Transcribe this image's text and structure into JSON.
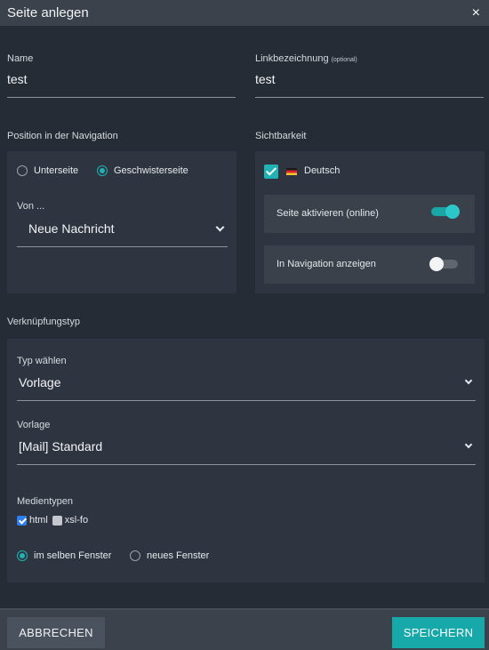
{
  "dialog": {
    "title": "Seite anlegen",
    "close_symbol": "×"
  },
  "name_field": {
    "label": "Name",
    "value": "test"
  },
  "link_field": {
    "label": "Linkbezeichnung",
    "optional_note": "(optional)",
    "value": "test"
  },
  "position": {
    "label": "Position in der Navigation",
    "options": [
      {
        "label": "Unterseite",
        "selected": false
      },
      {
        "label": "Geschwisterseite",
        "selected": true
      }
    ],
    "von_label": "Von ...",
    "von_value": "Neue Nachricht"
  },
  "visibility": {
    "label": "Sichtbarkeit",
    "language": "Deutsch",
    "language_checked": true,
    "activate_label": "Seite aktivieren (online)",
    "activate_on": true,
    "nav_label": "In Navigation anzeigen",
    "nav_on": false
  },
  "link_type": {
    "label": "Verknüpfungstyp",
    "type_label": "Typ wählen",
    "type_value": "Vorlage",
    "template_label": "Vorlage",
    "template_value": "[Mail] Standard",
    "media_label": "Medientypen",
    "media": [
      {
        "label": "html",
        "checked": true
      },
      {
        "label": "xsl-fo",
        "checked": false
      }
    ],
    "window_options": [
      {
        "label": "im selben Fenster",
        "selected": true
      },
      {
        "label": "neues Fenster",
        "selected": false
      }
    ]
  },
  "footer": {
    "cancel_label": "ABBRECHEN",
    "save_label": "SPEICHERN"
  },
  "colors": {
    "accent": "#1fb3b5",
    "background": "#262c36",
    "panel": "#2f3540"
  }
}
